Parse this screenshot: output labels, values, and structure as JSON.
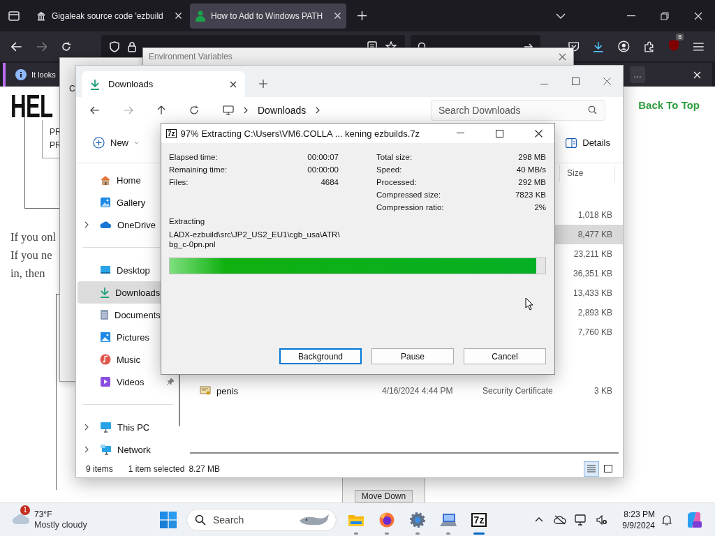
{
  "browser": {
    "tabs": [
      {
        "title": "Gigaleak source code 'ezbuild",
        "kind": "archive",
        "selected": false
      },
      {
        "title": "How to Add to Windows PATH",
        "kind": "site",
        "selected": true
      }
    ],
    "extension_badge": "8",
    "notice": {
      "text": "It looks",
      "button": "…"
    }
  },
  "page": {
    "logo": "HEL",
    "list_items": [
      "PR",
      "PR"
    ],
    "paragraph_lines": [
      "If you onl",
      "If you ne",
      "in, then"
    ],
    "back_to_top": "Back To Top",
    "move_down": "Move Down"
  },
  "system_properties": {
    "tab": "C"
  },
  "environment_variables": {
    "title": "Environment Variables"
  },
  "explorer": {
    "tab": "Downloads",
    "breadcrumb": "Downloads",
    "search_placeholder": "Search Downloads",
    "new_button": "New",
    "details_button": "Details",
    "sidebar": [
      {
        "items": [
          {
            "label": "Home",
            "kind": "home",
            "expandable": false,
            "pinned": false,
            "selected": false
          },
          {
            "label": "Gallery",
            "kind": "gallery",
            "expandable": false,
            "pinned": false,
            "selected": false
          },
          {
            "label": "OneDrive",
            "kind": "cloud",
            "expandable": true,
            "pinned": false,
            "selected": false
          }
        ]
      },
      {
        "items": [
          {
            "label": "Desktop",
            "kind": "desktop",
            "expandable": false,
            "pinned": false,
            "selected": false
          },
          {
            "label": "Downloads",
            "kind": "download",
            "expandable": false,
            "pinned": false,
            "selected": true
          },
          {
            "label": "Documents",
            "kind": "documents",
            "expandable": false,
            "pinned": false,
            "selected": false
          },
          {
            "label": "Pictures",
            "kind": "pictures",
            "expandable": false,
            "pinned": false,
            "selected": false
          },
          {
            "label": "Music",
            "kind": "music",
            "expandable": false,
            "pinned": false,
            "selected": false
          },
          {
            "label": "Videos",
            "kind": "videos",
            "expandable": false,
            "pinned": true,
            "selected": false
          }
        ]
      },
      {
        "items": [
          {
            "label": "This PC",
            "kind": "pc",
            "expandable": true,
            "pinned": false,
            "selected": false
          },
          {
            "label": "Network",
            "kind": "network",
            "expandable": true,
            "pinned": false,
            "selected": false
          }
        ]
      }
    ],
    "size_header": "Size",
    "files": [
      {
        "size": "1,018 KB",
        "selected": false
      },
      {
        "size": "8,477 KB",
        "selected": true
      },
      {
        "size": "23,211 KB",
        "selected": false
      },
      {
        "size": "36,351 KB",
        "selected": false
      },
      {
        "size": "13,433 KB",
        "selected": false
      },
      {
        "size": "2,893 KB",
        "selected": false
      },
      {
        "size": "7,760 KB",
        "selected": false
      },
      {
        "name": "penis",
        "date": "4/16/2024 4:44 PM",
        "type": "Security Certificate",
        "size": "3 KB",
        "selected": false
      }
    ],
    "status": {
      "count": "9 items",
      "selection": "1 item selected",
      "selection_size": "8.27 MB"
    },
    "view": [
      {
        "kind": "details",
        "selected": true
      },
      {
        "kind": "tiles",
        "selected": false
      }
    ]
  },
  "sevenzip": {
    "icon_text": "7z",
    "title": "97% Extracting C:\\Users\\VM6.COLLA ... kening ezbuilds.7z",
    "left_stats": [
      {
        "label": "Elapsed time:",
        "value": "00:00:07"
      },
      {
        "label": "Remaining time:",
        "value": "00:00:00"
      },
      {
        "label": "Files:",
        "value": "4684"
      }
    ],
    "right_stats": [
      {
        "label": "Total size:",
        "value": "298 MB"
      },
      {
        "label": "Speed:",
        "value": "40 MB/s"
      },
      {
        "label": "Processed:",
        "value": "292 MB"
      },
      {
        "label": "Compressed size:",
        "value": "7823 KB"
      },
      {
        "label": "Compression ratio:",
        "value": "2%"
      }
    ],
    "current_label": "Extracting",
    "current_path": [
      "LADX-ezbuild\\src\\JP2_US2_EU1\\cgb_usa\\ATR\\",
      "bg_c-0pn.pnl"
    ],
    "level": 0.975,
    "buttons": [
      {
        "label": "Background",
        "focused": true
      },
      {
        "label": "Pause",
        "focused": false
      },
      {
        "label": "Cancel",
        "focused": false
      }
    ]
  },
  "taskbar": {
    "weather": {
      "badge": "1",
      "temperature": "73°F",
      "condition": "Mostly cloudy"
    },
    "search": "Search",
    "apps": [
      {
        "kind": "files",
        "selected": false
      },
      {
        "kind": "firefox",
        "selected": false
      },
      {
        "kind": "settings",
        "selected": false
      },
      {
        "kind": "remote",
        "selected": false
      },
      {
        "kind": "sevenzip",
        "icon_text": "7z",
        "selected": true
      }
    ],
    "tray": [
      {
        "kind": "chevron"
      },
      {
        "kind": "cloud-off"
      },
      {
        "kind": "monitor"
      },
      {
        "kind": "mute"
      }
    ],
    "time": "8:23 PM",
    "date": "9/9/2024"
  }
}
